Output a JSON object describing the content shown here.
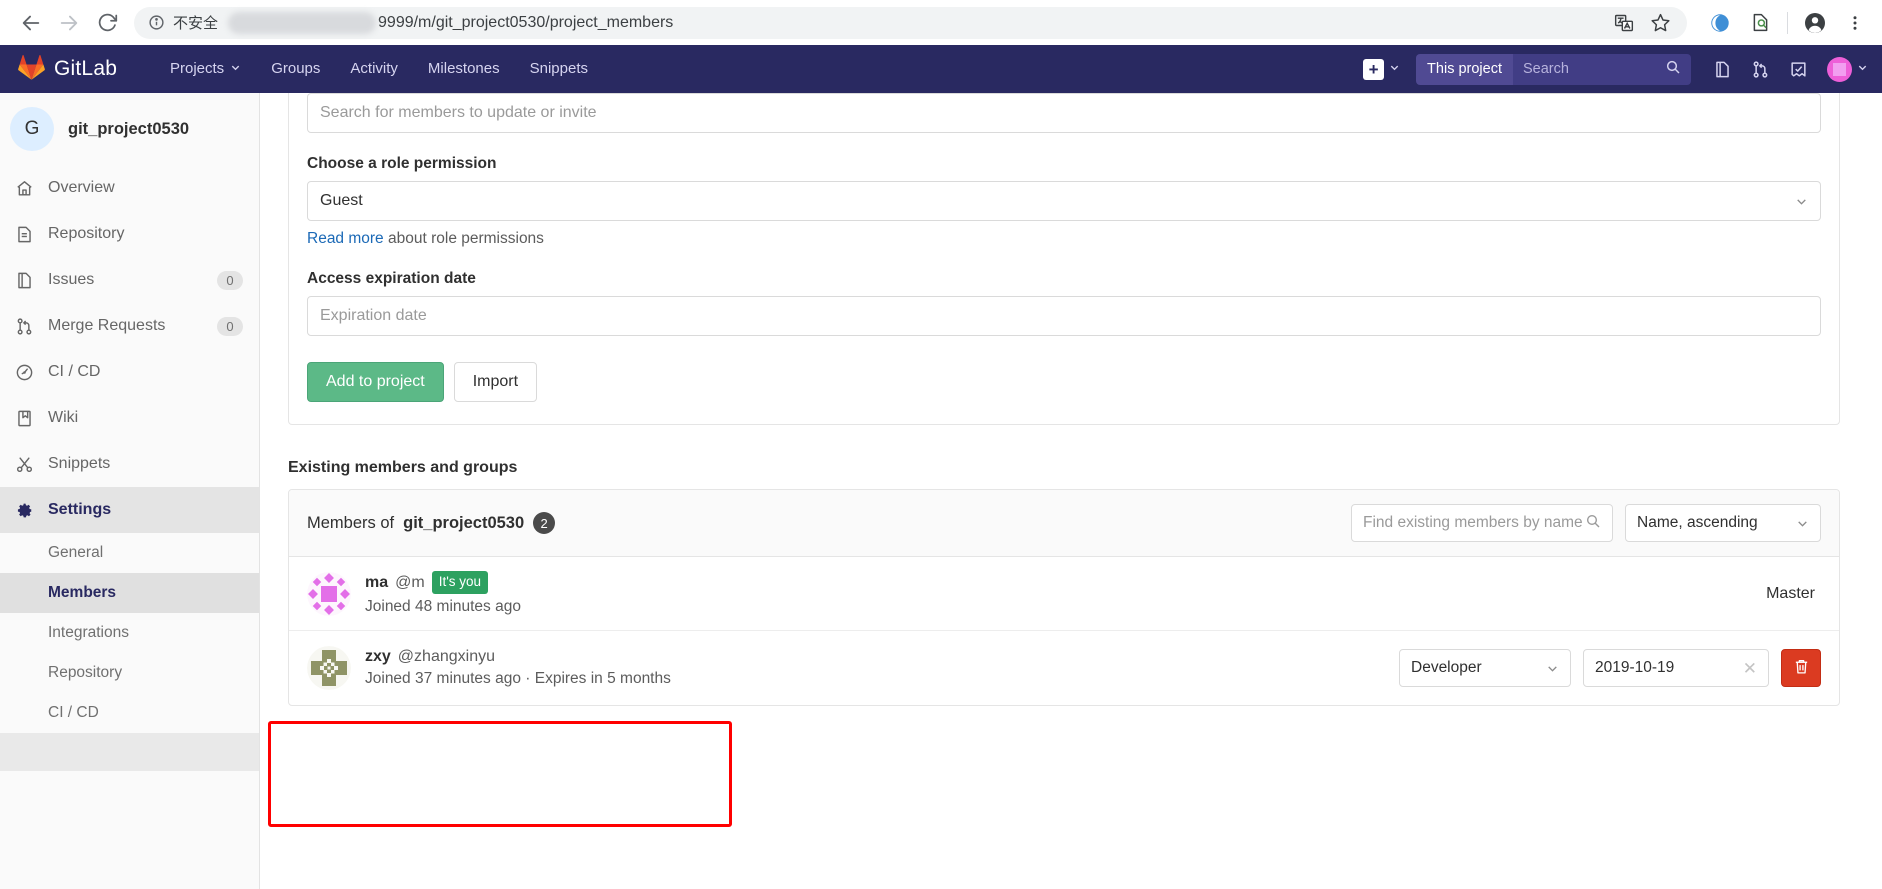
{
  "browser": {
    "back_icon": "back-arrow-icon",
    "forward_icon": "forward-arrow-icon",
    "reload_icon": "reload-icon",
    "info_icon": "info-icon",
    "insecure_label": "不安全",
    "url": "9999/m/git_project0530/project_members",
    "toolbar_icons": [
      "translate-icon",
      "bookmark-star-icon",
      "extension-circle-icon",
      "extension-search-doc-icon",
      "profile-avatar-icon",
      "three-dot-menu-icon"
    ]
  },
  "navbar": {
    "brand": "GitLab",
    "links": [
      {
        "label": "Projects",
        "has_chevron": true
      },
      {
        "label": "Groups",
        "has_chevron": false
      },
      {
        "label": "Activity",
        "has_chevron": false
      },
      {
        "label": "Milestones",
        "has_chevron": false
      },
      {
        "label": "Snippets",
        "has_chevron": false
      }
    ],
    "plus_label": "+",
    "search_scope": "This project",
    "search_placeholder": "Search",
    "icons": [
      "issues-icon",
      "merge-requests-icon",
      "todos-icon"
    ]
  },
  "sidebar": {
    "project_initial": "G",
    "project_name": "git_project0530",
    "items": [
      {
        "label": "Overview",
        "icon": "home-icon",
        "badge": ""
      },
      {
        "label": "Repository",
        "icon": "document-icon",
        "badge": ""
      },
      {
        "label": "Issues",
        "icon": "issues-icon",
        "badge": "0"
      },
      {
        "label": "Merge Requests",
        "icon": "merge-requests-icon",
        "badge": "0"
      },
      {
        "label": "CI / CD",
        "icon": "rocket-gauge-icon",
        "badge": ""
      },
      {
        "label": "Wiki",
        "icon": "book-icon",
        "badge": ""
      },
      {
        "label": "Snippets",
        "icon": "scissors-icon",
        "badge": ""
      },
      {
        "label": "Settings",
        "icon": "gear-icon",
        "badge": ""
      }
    ],
    "settings_subitems": [
      {
        "label": "General",
        "active": false
      },
      {
        "label": "Members",
        "active": true
      },
      {
        "label": "Integrations",
        "active": false
      },
      {
        "label": "Repository",
        "active": false
      },
      {
        "label": "CI / CD",
        "active": false
      }
    ]
  },
  "invite_form": {
    "search_placeholder": "Search for members to update or invite",
    "role_label": "Choose a role permission",
    "role_value": "Guest",
    "help_link": "Read more",
    "help_rest": " about role permissions",
    "expiration_label": "Access expiration date",
    "expiration_placeholder": "Expiration date",
    "submit_label": "Add to project",
    "import_label": "Import"
  },
  "existing": {
    "section_title": "Existing members and groups",
    "head_prefix": "Members of",
    "project_name": "git_project0530",
    "count": "2",
    "find_placeholder": "Find existing members by name",
    "sort_value": "Name, ascending",
    "members": [
      {
        "name": "ma",
        "handle": "@m",
        "badge": "It's you",
        "meta": "Joined 48 minutes ago",
        "role_static": "Master",
        "role_select": "",
        "expiry": "",
        "avatar_color": "#ee5fd8",
        "editable": false,
        "highlighted": false
      },
      {
        "name": "zxy",
        "handle": "@zhangxinyu",
        "badge": "",
        "meta": "Joined 37 minutes ago · Expires in 5 months",
        "role_static": "",
        "role_select": "Developer",
        "expiry": "2019-10-19",
        "avatar_color": "#8f9466",
        "editable": true,
        "highlighted": true
      }
    ]
  },
  "colors": {
    "navbar": "#292961",
    "success": "#5cb987",
    "badge_green": "#2da160",
    "danger": "#db3b21",
    "link": "#1b69b6",
    "annotation": "#ff0000"
  }
}
